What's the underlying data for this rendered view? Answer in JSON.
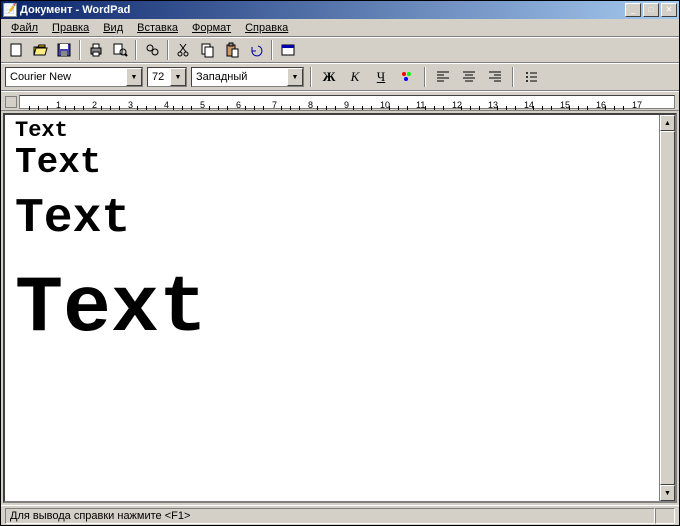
{
  "title": "Документ - WordPad",
  "menubar": [
    "Файл",
    "Правка",
    "Вид",
    "Вставка",
    "Формат",
    "Справка"
  ],
  "format": {
    "font": "Courier New",
    "size": "72",
    "script": "Западный",
    "bold": "Ж",
    "italic": "К",
    "underline": "Ч"
  },
  "document": {
    "line1": "Text",
    "line2": "Text",
    "line3": "Text",
    "line4": "Text"
  },
  "ruler": {
    "marks": [
      "1",
      "2",
      "3",
      "4",
      "5",
      "6",
      "7",
      "8",
      "9",
      "10",
      "11",
      "12",
      "13",
      "14",
      "15",
      "16",
      "17"
    ]
  },
  "statusbar": "Для вывода справки нажмите <F1>"
}
